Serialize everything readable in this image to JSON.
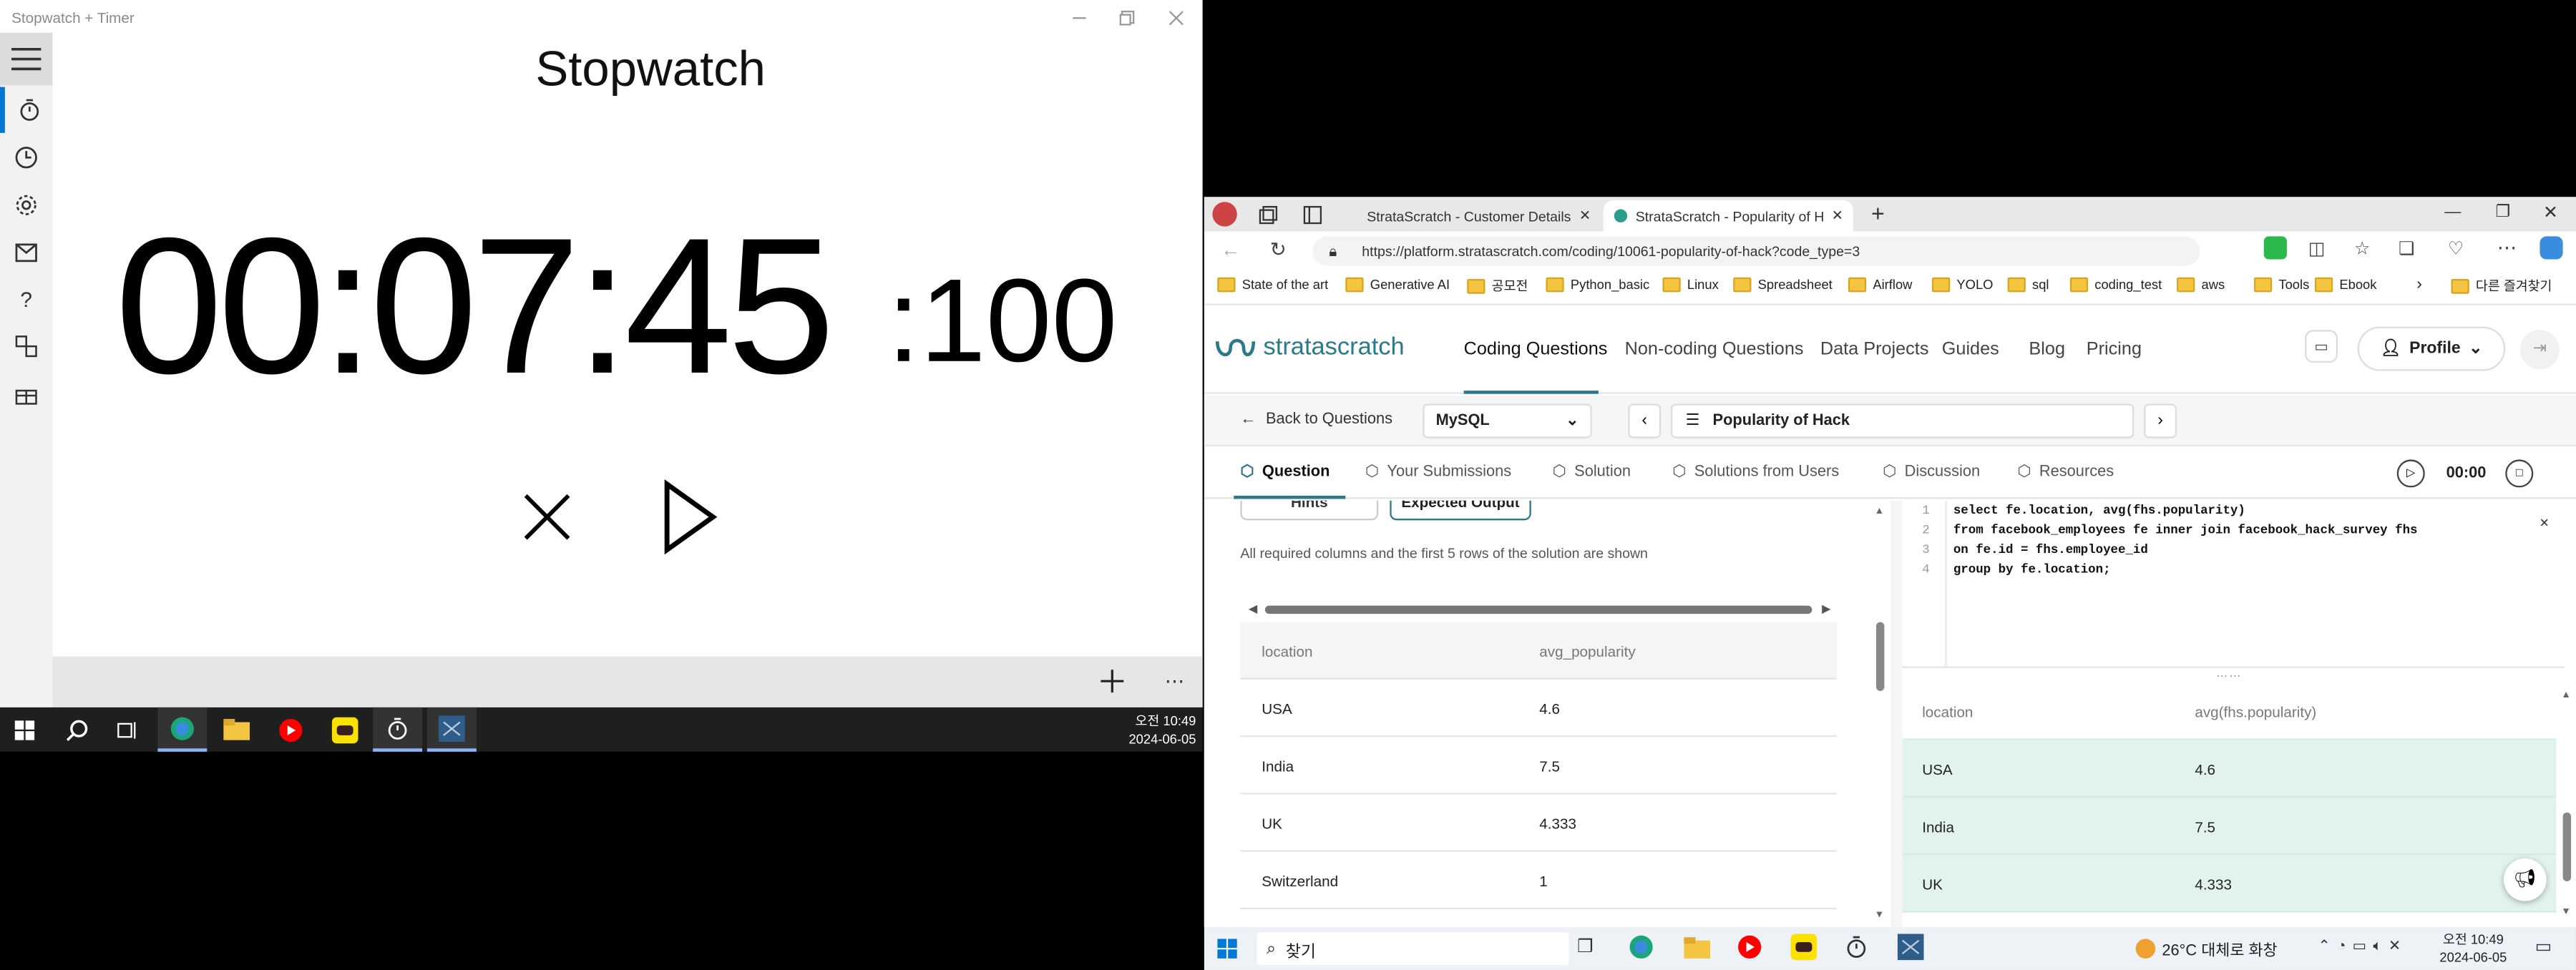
{
  "stopwatch": {
    "window_title": "Stopwatch + Timer",
    "heading": "Stopwatch",
    "time_main": "00:07:45",
    "time_ms": ":100"
  },
  "taskbar_left": {
    "time": "오전 10:49",
    "date": "2024-06-05"
  },
  "browser": {
    "tabs": [
      {
        "label": "StrataScratch - Customer Details"
      },
      {
        "label": "StrataScratch - Popularity of Hack"
      }
    ],
    "url": "https://platform.stratascratch.com/coding/10061-popularity-of-hack?code_type=3",
    "bookmarks": [
      "State of the art",
      "Generative AI",
      "공모전",
      "Python_basic",
      "Linux",
      "Spreadsheet",
      "Airflow",
      "YOLO",
      "sql",
      "coding_test",
      "aws",
      "Tools",
      "Ebook"
    ],
    "other_bookmarks": "다른 즐겨찾기"
  },
  "site": {
    "logo": "stratascratch",
    "nav": [
      "Coding Questions",
      "Non-coding Questions",
      "Data Projects",
      "Guides",
      "Blog",
      "Pricing"
    ],
    "profile": "Profile",
    "back": "Back to Questions",
    "dialect": "MySQL",
    "question_title": "Popularity of Hack",
    "tabs": [
      "Question",
      "Your Submissions",
      "Solution",
      "Solutions from Users",
      "Discussion",
      "Resources"
    ],
    "timer": "00:00",
    "hints": "Hints",
    "expected_output": "Expected Output",
    "note": "All required columns and the first 5 rows of the solution are shown",
    "expected": {
      "columns": [
        "location",
        "avg_popularity"
      ],
      "rows": [
        [
          "USA",
          "4.6"
        ],
        [
          "India",
          "7.5"
        ],
        [
          "UK",
          "4.333"
        ],
        [
          "Switzerland",
          "1"
        ]
      ]
    },
    "code_lines": [
      {
        "n": "1",
        "text": "select fe.location, avg(fhs.popularity)"
      },
      {
        "n": "2",
        "text": "from facebook_employees fe inner join facebook_hack_survey fhs"
      },
      {
        "n": "3",
        "text": "on fe.id = fhs.employee_id"
      },
      {
        "n": "4",
        "text": "group by fe.location;"
      }
    ],
    "result": {
      "columns": [
        "location",
        "avg(fhs.popularity)"
      ],
      "rows": [
        [
          "USA",
          "4.6"
        ],
        [
          "India",
          "7.5"
        ],
        [
          "UK",
          "4.333"
        ]
      ]
    }
  },
  "taskbar_right": {
    "search": "찾기",
    "weather": "26°C 대체로 화창",
    "time": "오전 10:49",
    "date": "2024-06-05"
  }
}
